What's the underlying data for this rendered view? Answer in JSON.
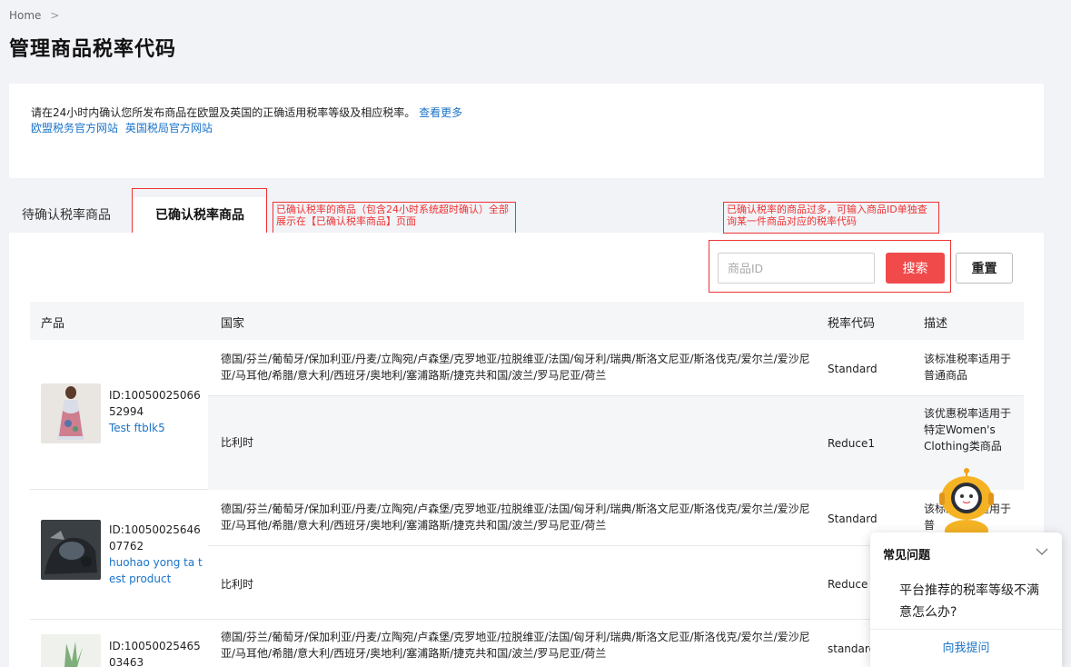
{
  "breadcrumb": {
    "home": "Home",
    "sep": ">"
  },
  "page_title": "管理商品税率代码",
  "notice": {
    "text": "请在24小时内确认您所发布商品在欧盟及英国的正确适用税率等级及相应税率。",
    "more_link": "查看更多",
    "eu_link": "欧盟税务官方网站",
    "uk_link": "英国税局官方网站"
  },
  "tabs": [
    {
      "label": "待确认税率商品",
      "active": false
    },
    {
      "label": "已确认税率商品",
      "active": true
    }
  ],
  "annotations": {
    "tab_note": "已确认税率的商品（包含24小时系统超时确认）全部展示在【已确认税率商品】页面",
    "search_note": "已确认税率的商品过多，可输入商品ID单独查询某一件商品对应的税率代码"
  },
  "search": {
    "placeholder": "商品ID",
    "search_label": "搜索",
    "reset_label": "重置"
  },
  "table": {
    "headers": {
      "product": "产品",
      "country": "国家",
      "code": "税率代码",
      "desc": "描述"
    },
    "rows": [
      {
        "id": "ID:1005002506652994",
        "name": "Test ftblk5",
        "subs": [
          {
            "country": "德国/芬兰/葡萄牙/保加利亚/丹麦/立陶宛/卢森堡/克罗地亚/拉脱维亚/法国/匈牙利/瑞典/斯洛文尼亚/斯洛伐克/爱尔兰/爱沙尼亚/马耳他/希腊/意大利/西班牙/奥地利/塞浦路斯/捷克共和国/波兰/罗马尼亚/荷兰",
            "code": "Standard",
            "desc": "该标准税率适用于普通商品"
          },
          {
            "country": "比利时",
            "code": "Reduce1",
            "desc": "该优惠税率适用于特定Women's Clothing类商品"
          }
        ]
      },
      {
        "id": "ID:1005002564607762",
        "name": "huohao yong ta test product",
        "subs": [
          {
            "country": "德国/芬兰/葡萄牙/保加利亚/丹麦/立陶宛/卢森堡/克罗地亚/拉脱维亚/法国/匈牙利/瑞典/斯洛文尼亚/斯洛伐克/爱尔兰/爱沙尼亚/马耳他/希腊/意大利/西班牙/奥地利/塞浦路斯/捷克共和国/波兰/罗马尼亚/荷兰",
            "code": "Standard",
            "desc": "该标准税率适用于普"
          },
          {
            "country": "比利时",
            "code": "Reduce",
            "desc": ""
          }
        ]
      },
      {
        "id": "ID:1005002546503463",
        "name": "",
        "subs": [
          {
            "country": "德国/芬兰/葡萄牙/保加利亚/丹麦/立陶宛/卢森堡/克罗地亚/拉脱维亚/法国/匈牙利/瑞典/斯洛文尼亚/斯洛伐克/爱尔兰/爱沙尼亚/马耳他/希腊/意大利/西班牙/奥地利/塞浦路斯/捷克共和国/波兰/罗马尼亚/荷兰",
            "code": "standard",
            "desc": ""
          }
        ]
      }
    ]
  },
  "faq": {
    "title": "常见问题",
    "question": "平台推荐的税率等级不满意怎么办?",
    "ask": "向我提问"
  },
  "colors": {
    "accent": "#f04a4a",
    "link": "#1a73c8",
    "annotation": "#e33333"
  }
}
